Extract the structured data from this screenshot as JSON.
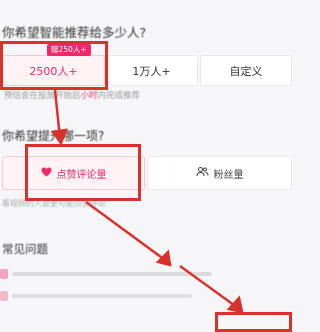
{
  "question1": {
    "prefix": "你希望智能推荐给",
    "suffix": "多少人?"
  },
  "reach_options": [
    {
      "label": "2500人+",
      "selected": true,
      "badge": "赠250人+"
    },
    {
      "label": "1万人+",
      "selected": false
    },
    {
      "label": "自定义",
      "selected": false
    }
  ],
  "hint1": {
    "prefix": "预估会在投放开始后",
    "highlight": "小时",
    "suffix": "内完成推荐"
  },
  "question2": "你希望提升哪一项?",
  "goal_options": [
    {
      "label": "点赞评论量",
      "icon": "heart-icon",
      "selected": true
    },
    {
      "label": "粉丝量",
      "icon": "people-icon",
      "selected": false
    }
  ],
  "hint2": "看视频的人会更可能点赞评论",
  "faq": {
    "title": "常见问题"
  },
  "colors": {
    "accent": "#ee2a6a",
    "annotation_red": "#d8322c"
  }
}
